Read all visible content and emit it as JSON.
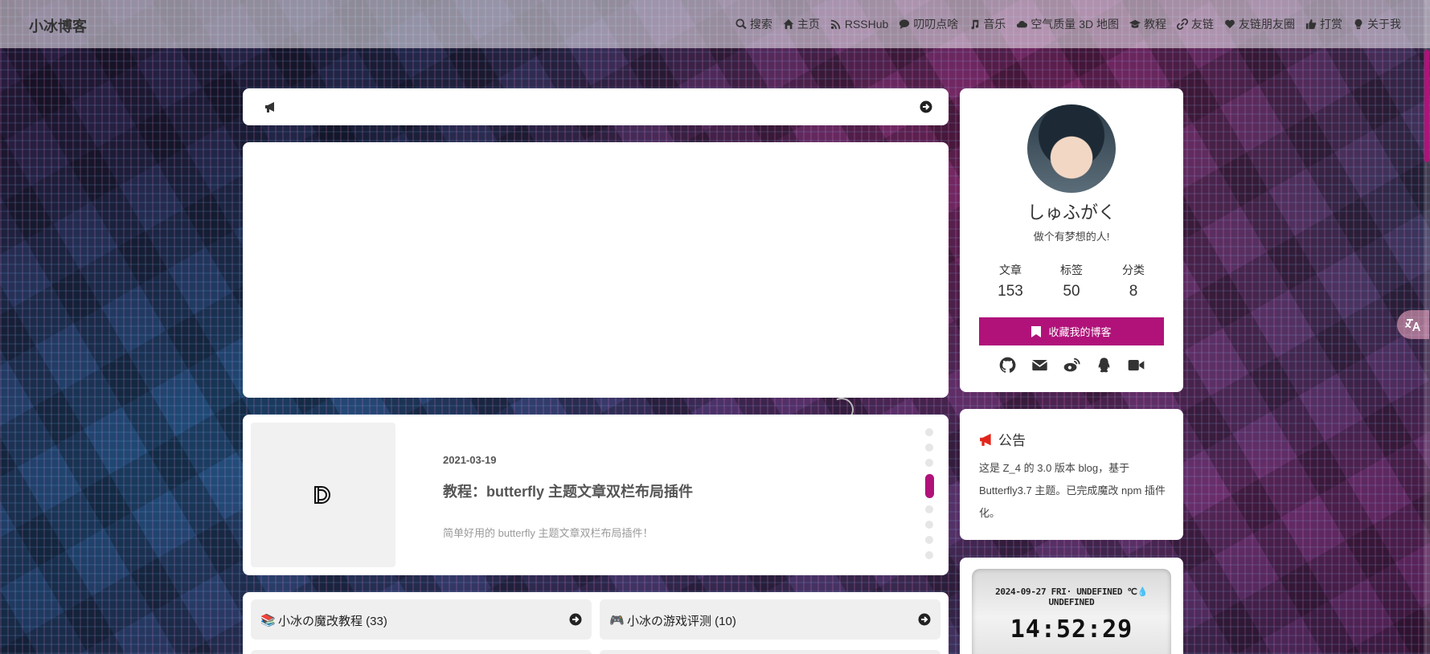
{
  "site": {
    "title": "小冰博客"
  },
  "nav": [
    {
      "label": "搜索",
      "icon": "search-icon"
    },
    {
      "label": "主页",
      "icon": "home-icon"
    },
    {
      "label": "RSSHub",
      "icon": "rss-icon"
    },
    {
      "label": "叨叨点啥",
      "icon": "comment-icon"
    },
    {
      "label": "音乐",
      "icon": "music-icon"
    },
    {
      "label": "空气质量 3D 地图",
      "icon": "cloud-icon"
    },
    {
      "label": "教程",
      "icon": "graduation-cap-icon"
    },
    {
      "label": "友链",
      "icon": "link-icon"
    },
    {
      "label": "友链朋友圈",
      "icon": "heart-icon"
    },
    {
      "label": "打赏",
      "icon": "thumbs-up-icon"
    },
    {
      "label": "关于我",
      "icon": "lightbulb-icon"
    }
  ],
  "article": {
    "date": "2021-03-19",
    "title": "教程：butterfly 主题文章双栏布局插件",
    "description": "简单好用的 butterfly 主题文章双栏布局插件！"
  },
  "categories": [
    {
      "icon": "📚",
      "label": "小冰の魔改教程 (33)"
    },
    {
      "icon": "🎮",
      "label": "小冰の游戏评测 (10)"
    }
  ],
  "profile": {
    "name": "しゅふがく",
    "motto": "做个有梦想的人!",
    "stats": [
      {
        "label": "文章",
        "value": "153"
      },
      {
        "label": "标签",
        "value": "50"
      },
      {
        "label": "分类",
        "value": "8"
      }
    ],
    "bookmark_label": "收藏我的博客",
    "socials": [
      "github-icon",
      "email-icon",
      "weibo-icon",
      "qq-icon",
      "video-icon"
    ]
  },
  "announcement": {
    "title": "公告",
    "body": "这是 Z_4 的 3.0 版本 blog，基于 Butterfly3.7 主题。已完成魔改 npm 插件化。"
  },
  "clock": {
    "date_line": "2024-09-27 FRI· UNDEFINED ℃💧 UNDEFINED",
    "time": "14:52:29"
  },
  "colors": {
    "accent": "#b0127a",
    "announcement_icon": "#e2251b"
  }
}
